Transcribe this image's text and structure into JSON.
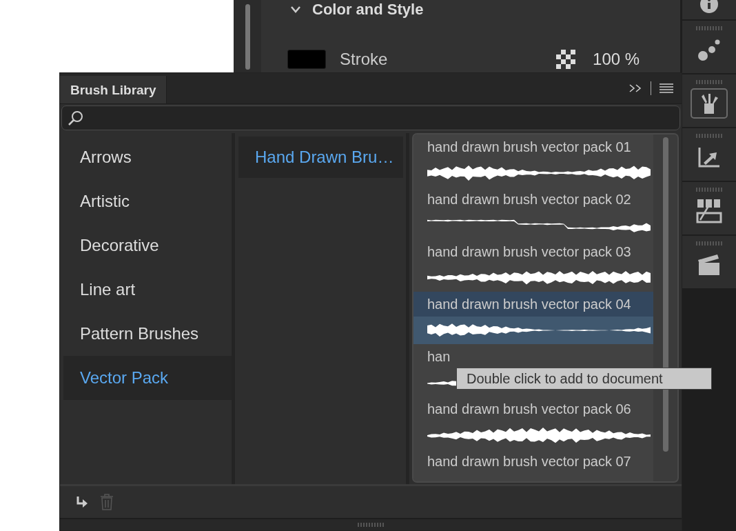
{
  "properties": {
    "section": "Color and Style",
    "expanded": true,
    "stroke": {
      "label": "Stroke",
      "color": "#000000",
      "opacity": "100 %"
    }
  },
  "tools": [
    {
      "kind": "info",
      "selected": false
    },
    {
      "kind": "dots",
      "selected": false
    },
    {
      "kind": "brushes",
      "selected": true
    },
    {
      "kind": "chart",
      "selected": false
    },
    {
      "kind": "storyboard",
      "selected": false
    },
    {
      "kind": "clapper",
      "selected": false
    }
  ],
  "brush_library": {
    "tab": "Brush Library",
    "categories": [
      {
        "label": "Arrows",
        "selected": false
      },
      {
        "label": "Artistic",
        "selected": false
      },
      {
        "label": "Decorative",
        "selected": false
      },
      {
        "label": "Line art",
        "selected": false
      },
      {
        "label": "Pattern Brushes",
        "selected": false
      },
      {
        "label": "Vector Pack",
        "selected": true
      }
    ],
    "sets": [
      {
        "label": "Hand Drawn Bru…",
        "selected": true
      }
    ],
    "brushes": [
      {
        "label": "hand drawn brush vector pack 01",
        "selected": false
      },
      {
        "label": "hand drawn brush vector pack 02",
        "selected": false
      },
      {
        "label": "hand drawn brush vector pack 03",
        "selected": false
      },
      {
        "label": "hand drawn brush vector pack 04",
        "selected": true
      },
      {
        "label": "han",
        "selected": false
      },
      {
        "label": "hand drawn brush vector pack 06",
        "selected": false
      },
      {
        "label": "hand drawn brush vector pack 07",
        "selected": false
      }
    ],
    "tooltip": "Double click to add to document"
  }
}
